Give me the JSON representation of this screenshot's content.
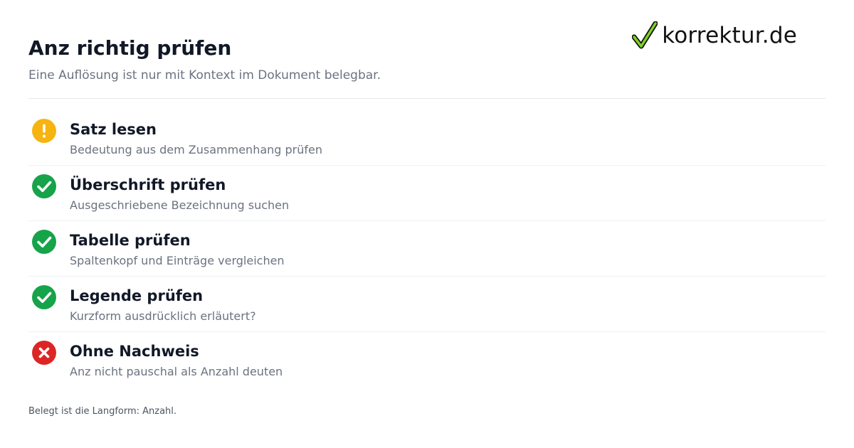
{
  "brand": {
    "name": "korrektur.de",
    "icon": "checkmark-logo-icon",
    "accent_color": "#7ed321"
  },
  "header": {
    "title": "Anz richtig prüfen",
    "subtitle": "Eine Auflösung ist nur mit Kontext im Dokument belegbar."
  },
  "checklist": {
    "items": [
      {
        "title": "Satz lesen",
        "description": "Bedeutung aus dem Zusammenhang prüfen",
        "status": "warning",
        "icon": "warning-icon",
        "color": "#f5b40f"
      },
      {
        "title": "Überschrift prüfen",
        "description": "Ausgeschriebene Bezeichnung suchen",
        "status": "ok",
        "icon": "check-icon",
        "color": "#16a34a"
      },
      {
        "title": "Tabelle prüfen",
        "description": "Spaltenkopf und Einträge vergleichen",
        "status": "ok",
        "icon": "check-icon",
        "color": "#16a34a"
      },
      {
        "title": "Legende prüfen",
        "description": "Kurzform ausdrücklich erläutert?",
        "status": "ok",
        "icon": "check-icon",
        "color": "#16a34a"
      },
      {
        "title": "Ohne Nachweis",
        "description": "Anz nicht pauschal als Anzahl deuten",
        "status": "error",
        "icon": "close-icon",
        "color": "#dc2626"
      }
    ]
  },
  "footer": {
    "note": "Belegt ist die Langform: Anzahl."
  }
}
